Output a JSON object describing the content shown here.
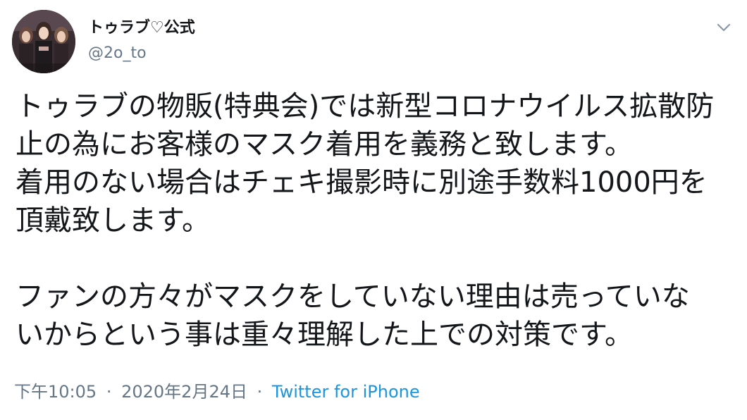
{
  "user": {
    "display_name": "トゥラブ♡公式",
    "handle": "@2o_to"
  },
  "icons": {
    "menu": "chevron-down-icon",
    "avatar": "group-photo-avatar"
  },
  "tweet": {
    "lines": [
      "トゥラブの物販(特典会)では新型コロナウイルス拡散防",
      "止の為にお客様のマスク着用を義務と致します。",
      "着用のない場合はチェキ撮影時に別途手数料1000円を",
      "頂戴致します。",
      "ファンの方々がマスクをしていない理由は売っていな",
      "いからという事は重々理解した上での対策です。"
    ],
    "time": "下午10:05",
    "separator": "·",
    "date": "2020年2月24日",
    "source": "Twitter for iPhone"
  },
  "colors": {
    "text": "#14171a",
    "secondary": "#657786",
    "link": "#1b95e0"
  }
}
